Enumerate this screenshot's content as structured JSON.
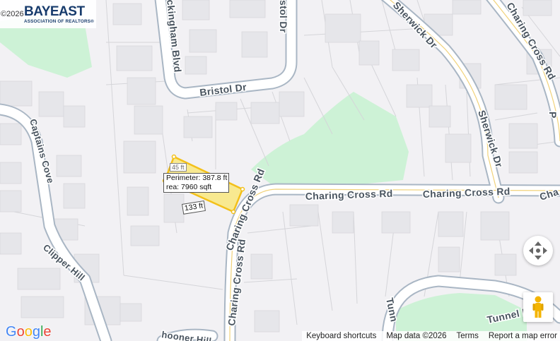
{
  "map": {
    "copyright_year": "©2026",
    "brand": {
      "name": "BAYEAST",
      "subtitle": "ASSOCIATION OF REALTORS®"
    },
    "road_labels": {
      "bristol_dr": "Bristol Dr",
      "bristol_dr_vertical": "stol Dr",
      "buckingham_blvd": "ckingham Blvd",
      "sherwick_dr_top": "Sherwick Dr",
      "sherwick_dr": "Sherwick Dr",
      "charing_cross_top": "Charing Cross Rd",
      "charing_cross_1": "Charing Cross Rd",
      "charing_cross_2": "Charing Cross Rd",
      "charing_cross_3": "Charing Cross Rd",
      "charing_cross_edge": "Cha",
      "captains_cove": "Captains Cove",
      "clipper_hill": "Clipper Hill",
      "schooner_hill": "hooner Hill",
      "tunnel_rd": "Tunnel R",
      "tunnel_vertical": "Tunn",
      "right_edge_p": "P"
    },
    "measurement": {
      "perimeter": "Perimeter: 387.8 ft",
      "area": "rea: 7960 sqft",
      "side_133": "133 ft",
      "side_small": "45 ft"
    },
    "google_logo": "Google",
    "footer": {
      "keyboard": "Keyboard shortcuts",
      "map_data": "Map data ©2026",
      "terms": "Terms",
      "report": "Report a map error"
    },
    "controls": {
      "move": "move-arrows-icon",
      "pegman": "pegman-icon"
    },
    "colors": {
      "road_fill": "#ffffff",
      "road_casing": "#a9b6c4",
      "center_line": "#f1d27a",
      "park": "#cdf2d6",
      "building": "#e8e8ec",
      "parcel_line": "#d3d3d7",
      "measure_fill": "#fbe55a",
      "measure_stroke": "#f3c01a"
    }
  }
}
